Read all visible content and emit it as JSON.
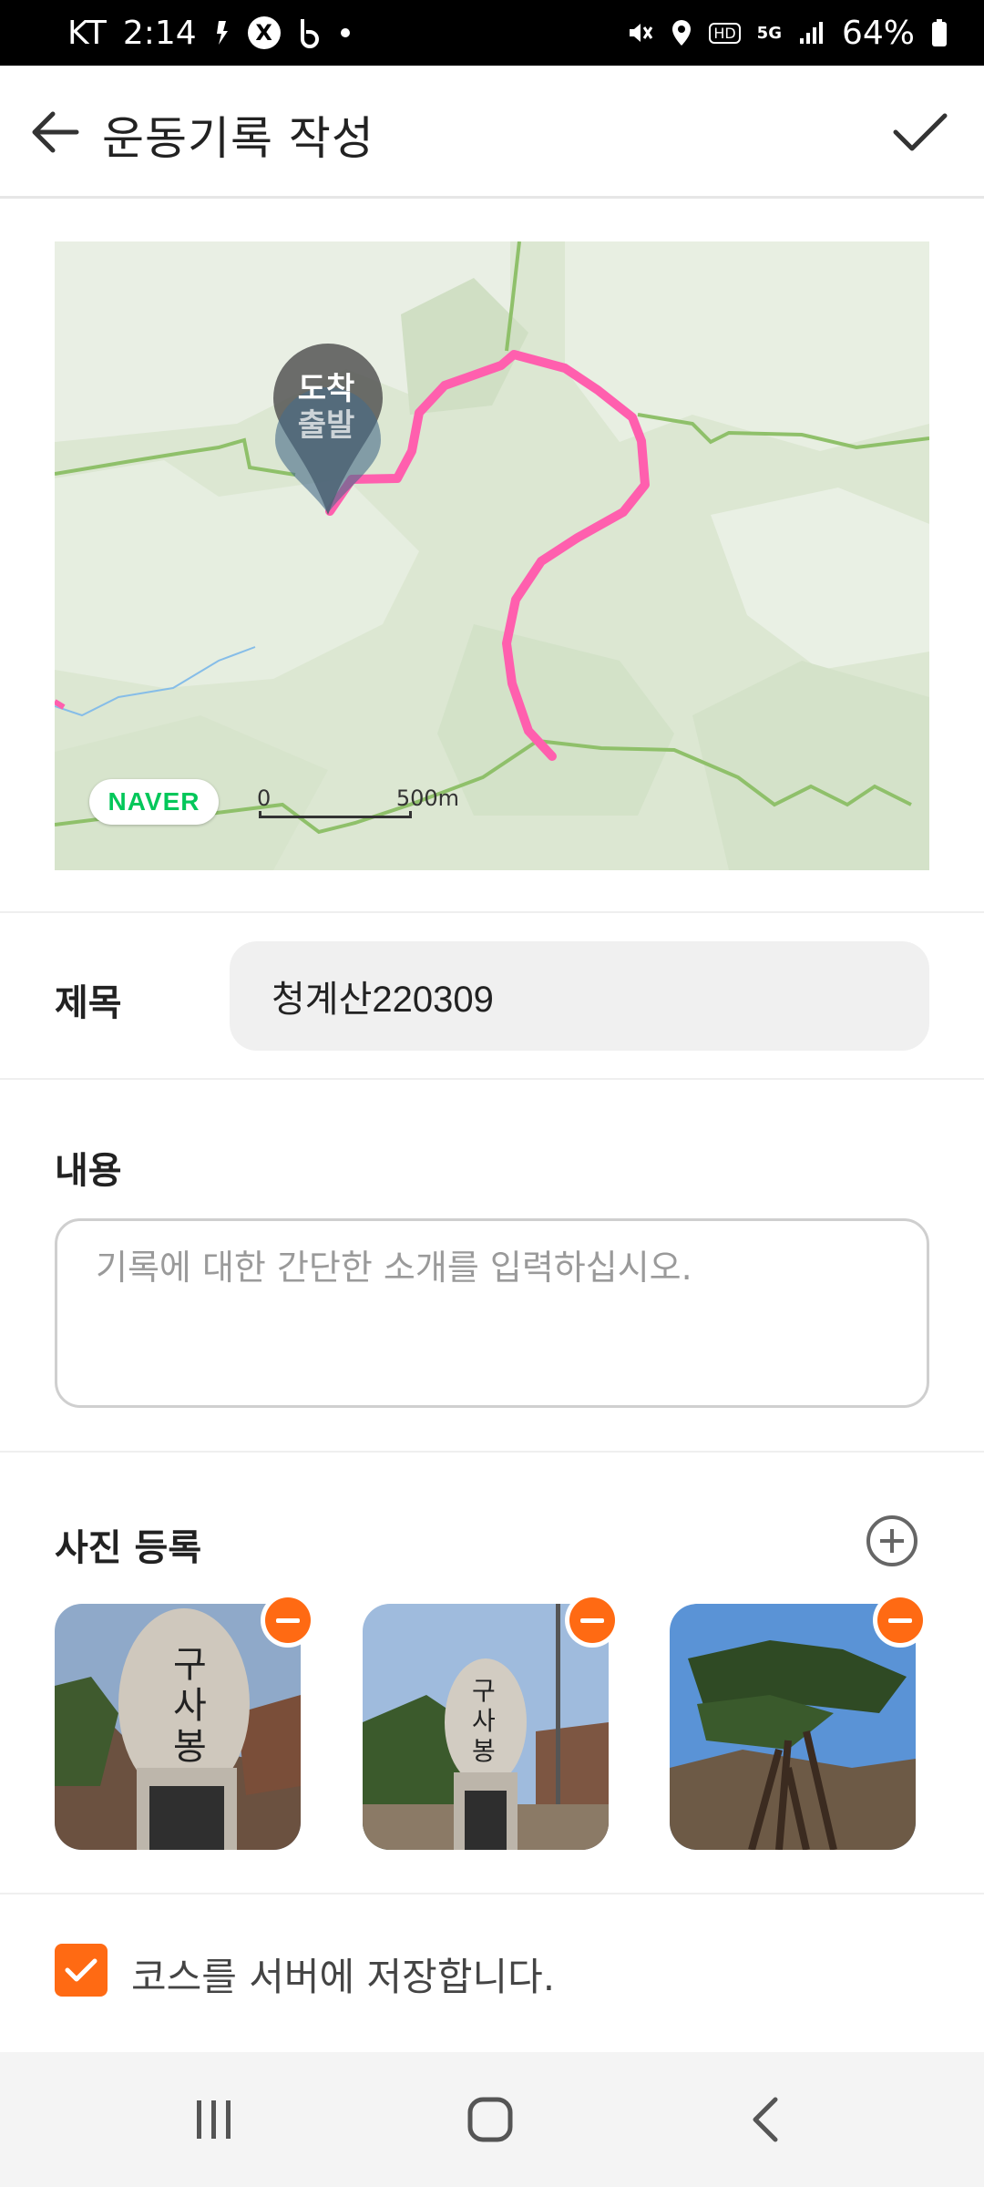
{
  "status_bar": {
    "carrier": "KT",
    "time": "2:14",
    "battery": "64%",
    "network": "5G",
    "hd": "HD"
  },
  "app_bar": {
    "title": "운동기록 작성",
    "back_icon": "arrow-left-icon",
    "confirm_icon": "check-icon"
  },
  "map": {
    "start_label": "출발",
    "end_label": "도착",
    "logo_text": "NAVER",
    "scale_start": "0",
    "scale_end": "500m",
    "route_color": "#ff5fae"
  },
  "form": {
    "title_label": "제목",
    "title_value": "청계산220309",
    "content_label": "내용",
    "content_placeholder": "기록에 대한 간단한 소개를 입력하십시오.",
    "photos_label": "사진 등록",
    "add_photo_icon": "plus-circle-icon",
    "photos": [
      {
        "name": "photo-1",
        "remove_icon": "minus-circle-icon"
      },
      {
        "name": "photo-2",
        "remove_icon": "minus-circle-icon"
      },
      {
        "name": "photo-3",
        "remove_icon": "minus-circle-icon"
      }
    ],
    "save_course_label": "코스를 서버에 저장합니다.",
    "save_course_checked": true
  },
  "colors": {
    "accent": "#ff6a13",
    "map_bg": "#dde8d4",
    "route": "#ff5fae",
    "naver_green": "#03c75a"
  },
  "nav_bar": {
    "recents_icon": "recent-apps-icon",
    "home_icon": "home-icon",
    "back_icon": "back-icon"
  }
}
